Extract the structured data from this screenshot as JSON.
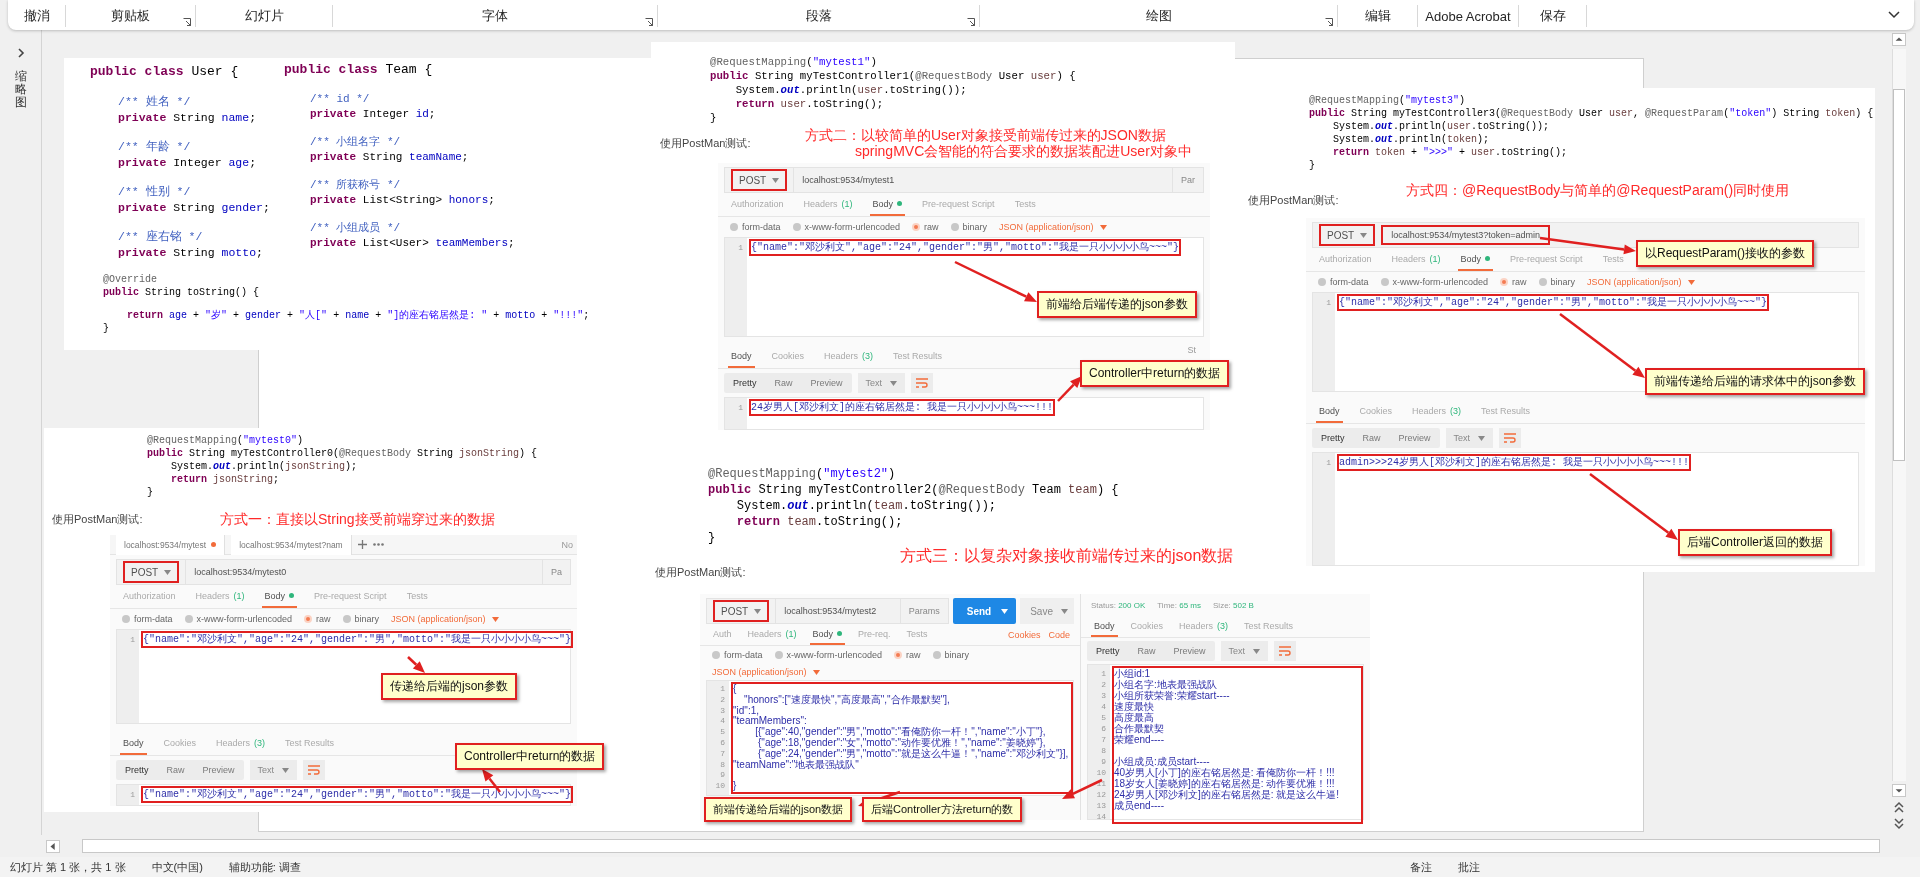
{
  "ribbon": {
    "groups": [
      {
        "label": "撤消",
        "launcher": false
      },
      {
        "label": "剪贴板",
        "launcher": true
      },
      {
        "label": "幻灯片",
        "launcher": false
      },
      {
        "label": "字体",
        "launcher": true
      },
      {
        "label": "段落",
        "launcher": true
      },
      {
        "label": "绘图",
        "launcher": true
      },
      {
        "label": "编辑",
        "launcher": false
      },
      {
        "label": "Adobe Acrobat",
        "launcher": false
      },
      {
        "label": "保存",
        "launcher": false
      }
    ]
  },
  "thumbnail_pane": {
    "label": "缩略图"
  },
  "slide": {
    "class_code": {
      "classes": [
        {
          "header": [
            {
              "kind": "keyword",
              "text": "public class "
            },
            {
              "kind": "plain",
              "text": "User {"
            }
          ],
          "members": [
            [
              [
                {
                  "kind": "comment",
                  "text": "/** 姓名 */"
                }
              ],
              [
                {
                  "kind": "keyword",
                  "text": "private "
                },
                {
                  "kind": "plain",
                  "text": "String "
                },
                {
                  "kind": "field",
                  "text": "name"
                },
                {
                  "kind": "plain",
                  "text": ";"
                }
              ]
            ],
            [
              [
                {
                  "kind": "comment",
                  "text": "/** 年龄 */"
                }
              ],
              [
                {
                  "kind": "keyword",
                  "text": "private "
                },
                {
                  "kind": "plain",
                  "text": "Integer "
                },
                {
                  "kind": "field",
                  "text": "age"
                },
                {
                  "kind": "plain",
                  "text": ";"
                }
              ]
            ],
            [
              [
                {
                  "kind": "comment",
                  "text": "/** 性别 */"
                }
              ],
              [
                {
                  "kind": "keyword",
                  "text": "private "
                },
                {
                  "kind": "plain",
                  "text": "String "
                },
                {
                  "kind": "field",
                  "text": "gender"
                },
                {
                  "kind": "plain",
                  "text": ";"
                }
              ]
            ],
            [
              [
                {
                  "kind": "comment",
                  "text": "/** 座右铭 */"
                }
              ],
              [
                {
                  "kind": "keyword",
                  "text": "private "
                },
                {
                  "kind": "plain",
                  "text": "String "
                },
                {
                  "kind": "field",
                  "text": "motto"
                },
                {
                  "kind": "plain",
                  "text": ";"
                }
              ]
            ]
          ]
        },
        {
          "header": [
            {
              "kind": "keyword",
              "text": "public class "
            },
            {
              "kind": "plain",
              "text": "Team {"
            }
          ],
          "members": [
            [
              [
                {
                  "kind": "comment",
                  "text": "/** id */"
                }
              ],
              [
                {
                  "kind": "keyword",
                  "text": "private "
                },
                {
                  "kind": "plain",
                  "text": "Integer "
                },
                {
                  "kind": "field",
                  "text": "id"
                },
                {
                  "kind": "plain",
                  "text": ";"
                }
              ]
            ],
            [
              [
                {
                  "kind": "comment",
                  "text": "/** 小组名字 */"
                }
              ],
              [
                {
                  "kind": "keyword",
                  "text": "private "
                },
                {
                  "kind": "plain",
                  "text": "String "
                },
                {
                  "kind": "field",
                  "text": "teamName"
                },
                {
                  "kind": "plain",
                  "text": ";"
                }
              ]
            ],
            [
              [
                {
                  "kind": "comment",
                  "text": "/** 所获称号 */"
                }
              ],
              [
                {
                  "kind": "keyword",
                  "text": "private "
                },
                {
                  "kind": "plain",
                  "text": "List<String> "
                },
                {
                  "kind": "field",
                  "text": "honors"
                },
                {
                  "kind": "plain",
                  "text": ";"
                }
              ]
            ],
            [
              [
                {
                  "kind": "comment",
                  "text": "/** 小组成员 */"
                }
              ],
              [
                {
                  "kind": "keyword",
                  "text": "private "
                },
                {
                  "kind": "plain",
                  "text": "List<User> "
                },
                {
                  "kind": "field",
                  "text": "teamMembers"
                },
                {
                  "kind": "plain",
                  "text": ";"
                }
              ]
            ]
          ]
        }
      ],
      "to_string": {
        "blocks": [
          [
            [
              {
                "kind": "annotation",
                "text": "@Override"
              }
            ],
            [
              {
                "kind": "keyword",
                "text": "public "
              },
              {
                "kind": "plain",
                "text": "String toString() {"
              }
            ]
          ],
          [
            [
              {
                "kind": "keyword",
                "text": "    return "
              },
              {
                "kind": "field",
                "text": "age"
              },
              {
                "kind": "plain",
                "text": " + "
              },
              {
                "kind": "string",
                "text": "\"岁\""
              },
              {
                "kind": "plain",
                "text": " + "
              },
              {
                "kind": "field",
                "text": "gender"
              },
              {
                "kind": "plain",
                "text": " + "
              },
              {
                "kind": "string",
                "text": "\"人[\""
              },
              {
                "kind": "plain",
                "text": " + "
              },
              {
                "kind": "field",
                "text": "name"
              },
              {
                "kind": "plain",
                "text": " + "
              },
              {
                "kind": "string",
                "text": "\"]的座右铭居然是: \""
              },
              {
                "kind": "plain",
                "text": " + "
              },
              {
                "kind": "field",
                "text": "motto"
              },
              {
                "kind": "plain",
                "text": " + "
              },
              {
                "kind": "string",
                "text": "\"!!!\""
              },
              {
                "kind": "plain",
                "text": ";"
              }
            ],
            [
              {
                "kind": "plain",
                "text": "}"
              }
            ]
          ]
        ]
      }
    },
    "examples": [
      {
        "code": [
          [
            {
              "kind": "annotation",
              "text": "@RequestMapping"
            },
            {
              "kind": "plain",
              "text": "("
            },
            {
              "kind": "string",
              "text": "\"mytest1\""
            },
            {
              "kind": "plain",
              "text": ")"
            }
          ],
          [
            {
              "kind": "keyword",
              "text": "public "
            },
            {
              "kind": "plain",
              "text": "String myTestController1("
            },
            {
              "kind": "annotation",
              "text": "@RequestBody "
            },
            {
              "kind": "plain",
              "text": "User "
            },
            {
              "kind": "variable",
              "text": "user"
            },
            {
              "kind": "plain",
              "text": ") {"
            }
          ],
          [
            {
              "kind": "plain",
              "text": "    System."
            },
            {
              "kind": "static",
              "text": "out"
            },
            {
              "kind": "plain",
              "text": ".println("
            },
            {
              "kind": "variable",
              "text": "user"
            },
            {
              "kind": "plain",
              "text": ".toString());"
            }
          ],
          [
            {
              "kind": "keyword",
              "text": "    return "
            },
            {
              "kind": "variable",
              "text": "user"
            },
            {
              "kind": "plain",
              "text": ".toString();"
            }
          ],
          [
            {
              "kind": "plain",
              "text": "}"
            }
          ]
        ],
        "test_label": "使用PostMan测试:",
        "title": [
          "方式二：以较简单的User对象接受前端传过来的JSON数据",
          "springMVC会智能的符合要求的数据装配进User对象中"
        ],
        "postman": {
          "kind": "stacked",
          "method": {
            "label": "POST",
            "highlighted": true
          },
          "url": {
            "text": "localhost:9534/mytest1",
            "highlighted": false
          },
          "url_extra": "Par",
          "request_tabs": [
            {
              "label": "Authorization",
              "selected": false
            },
            {
              "label": "Headers",
              "count": "(1)",
              "selected": false
            },
            {
              "label": "Body",
              "selected": true,
              "dot": true
            },
            {
              "label": "Pre-request Script",
              "selected": false
            },
            {
              "label": "Tests",
              "selected": false
            }
          ],
          "body_types": [
            {
              "label": "form-data",
              "selected": false
            },
            {
              "label": "x-www-form-urlencoded",
              "selected": false
            },
            {
              "label": "raw",
              "selected": true
            },
            {
              "label": "binary",
              "selected": false
            }
          ],
          "content_type": "JSON (application/json)",
          "request_body": {
            "highlighted": true,
            "lines": [
              {
                "no": "1",
                "text": "{\"name\":\"邓沙利文\",\"age\":\"24\",\"gender\":\"男\",\"motto\":\"我是一只小小小小鸟~~~\"}"
              }
            ]
          },
          "response_tabs": [
            {
              "label": "Body",
              "selected": true
            },
            {
              "label": "Cookies",
              "selected": false
            },
            {
              "label": "Headers",
              "count": "(3)",
              "selected": false
            },
            {
              "label": "Test Results",
              "selected": false
            }
          ],
          "response_extra": "St",
          "view_modes": [
            {
              "label": "Pretty",
              "selected": true
            },
            {
              "label": "Raw",
              "selected": false
            },
            {
              "label": "Preview",
              "selected": false
            }
          ],
          "format": "Text",
          "response_body": {
            "highlighted": true,
            "lines": [
              {
                "no": "1",
                "text": "24岁男人[邓沙利文]的座右铭居然是: 我是一只小小小小鸟~~~!!!"
              }
            ]
          }
        },
        "callouts": [
          {
            "text": "前端给后端传递的json参数"
          },
          {
            "text": "Controller中return的数据"
          }
        ]
      },
      {
        "code": [
          [
            {
              "kind": "annotation",
              "text": "@RequestMapping"
            },
            {
              "kind": "plain",
              "text": "("
            },
            {
              "kind": "string",
              "text": "\"mytest3\""
            },
            {
              "kind": "plain",
              "text": ")"
            }
          ],
          [
            {
              "kind": "keyword",
              "text": "public "
            },
            {
              "kind": "plain",
              "text": "String myTestController3("
            },
            {
              "kind": "annotation",
              "text": "@RequestBody "
            },
            {
              "kind": "plain",
              "text": "User "
            },
            {
              "kind": "variable",
              "text": "user"
            },
            {
              "kind": "plain",
              "text": ", "
            },
            {
              "kind": "annotation",
              "text": "@RequestParam"
            },
            {
              "kind": "plain",
              "text": "("
            },
            {
              "kind": "string",
              "text": "\"token\""
            },
            {
              "kind": "plain",
              "text": ") String "
            },
            {
              "kind": "variable",
              "text": "token"
            },
            {
              "kind": "plain",
              "text": ") {"
            }
          ],
          [
            {
              "kind": "plain",
              "text": "    System."
            },
            {
              "kind": "static",
              "text": "out"
            },
            {
              "kind": "plain",
              "text": ".println("
            },
            {
              "kind": "variable",
              "text": "user"
            },
            {
              "kind": "plain",
              "text": ".toString());"
            }
          ],
          [
            {
              "kind": "plain",
              "text": "    System."
            },
            {
              "kind": "static",
              "text": "out"
            },
            {
              "kind": "plain",
              "text": ".println("
            },
            {
              "kind": "variable",
              "text": "token"
            },
            {
              "kind": "plain",
              "text": ");"
            }
          ],
          [
            {
              "kind": "keyword",
              "text": "    return "
            },
            {
              "kind": "variable",
              "text": "token"
            },
            {
              "kind": "plain",
              "text": " + "
            },
            {
              "kind": "string",
              "text": "\">>>\""
            },
            {
              "kind": "plain",
              "text": " + "
            },
            {
              "kind": "variable",
              "text": "user"
            },
            {
              "kind": "plain",
              "text": ".toString();"
            }
          ],
          [
            {
              "kind": "plain",
              "text": "}"
            }
          ]
        ],
        "test_label": "使用PostMan测试:",
        "title": [
          "方式四：@RequestBody与简单的@RequestParam()同时使用"
        ],
        "postman": {
          "kind": "stacked",
          "method": {
            "label": "POST",
            "highlighted": true
          },
          "url": {
            "text": "localhost:9534/mytest3?token=admin",
            "highlighted": true
          },
          "request_tabs": [
            {
              "label": "Authorization",
              "selected": false
            },
            {
              "label": "Headers",
              "count": "(1)",
              "selected": false
            },
            {
              "label": "Body",
              "selected": true,
              "dot": true
            },
            {
              "label": "Pre-request Script",
              "selected": false
            },
            {
              "label": "Tests",
              "selected": false
            }
          ],
          "body_types": [
            {
              "label": "form-data",
              "selected": false
            },
            {
              "label": "x-www-form-urlencoded",
              "selected": false
            },
            {
              "label": "raw",
              "selected": true
            },
            {
              "label": "binary",
              "selected": false
            }
          ],
          "content_type": "JSON (application/json)",
          "request_body": {
            "highlighted": true,
            "lines": [
              {
                "no": "1",
                "text": "{\"name\":\"邓沙利文\",\"age\":\"24\",\"gender\":\"男\",\"motto\":\"我是一只小小小小鸟~~~\"}"
              }
            ]
          },
          "response_tabs": [
            {
              "label": "Body",
              "selected": true
            },
            {
              "label": "Cookies",
              "selected": false
            },
            {
              "label": "Headers",
              "count": "(3)",
              "selected": false
            },
            {
              "label": "Test Results",
              "selected": false
            }
          ],
          "view_modes": [
            {
              "label": "Pretty",
              "selected": true
            },
            {
              "label": "Raw",
              "selected": false
            },
            {
              "label": "Preview",
              "selected": false
            }
          ],
          "format": "Text",
          "response_body": {
            "highlighted": true,
            "lines": [
              {
                "no": "1",
                "text": "admin>>>24岁男人[邓沙利文]的座右铭居然是: 我是一只小小小小鸟~~~!!!"
              }
            ]
          }
        },
        "callouts": [
          {
            "text": "以RequestParam()接收的参数"
          },
          {
            "text": "前端传递给后端的请求体中的json参数"
          },
          {
            "text": "后端Controller返回的数据"
          }
        ]
      },
      {
        "code": [
          [
            {
              "kind": "annotation",
              "text": "@RequestMapping"
            },
            {
              "kind": "plain",
              "text": "("
            },
            {
              "kind": "string",
              "text": "\"mytest0\""
            },
            {
              "kind": "plain",
              "text": ")"
            }
          ],
          [
            {
              "kind": "keyword",
              "text": "public "
            },
            {
              "kind": "plain",
              "text": "String myTestController0("
            },
            {
              "kind": "annotation",
              "text": "@RequestBody "
            },
            {
              "kind": "plain",
              "text": "String "
            },
            {
              "kind": "variable",
              "text": "jsonString"
            },
            {
              "kind": "plain",
              "text": ") {"
            }
          ],
          [
            {
              "kind": "plain",
              "text": "    System."
            },
            {
              "kind": "static",
              "text": "out"
            },
            {
              "kind": "plain",
              "text": ".println("
            },
            {
              "kind": "variable",
              "text": "jsonString"
            },
            {
              "kind": "plain",
              "text": ");"
            }
          ],
          [
            {
              "kind": "keyword",
              "text": "    return "
            },
            {
              "kind": "variable",
              "text": "jsonString"
            },
            {
              "kind": "plain",
              "text": ";"
            }
          ],
          [
            {
              "kind": "plain",
              "text": "}"
            }
          ]
        ],
        "test_label": "使用PostMan测试:",
        "title": [
          "方式一：直接以String接受前端穿过来的数据"
        ],
        "postman": {
          "kind": "stacked",
          "tabs": [
            {
              "label": "localhost:9534/mytest",
              "modified": true
            },
            {
              "label": "localhost:9534/mytest?nam",
              "modified": false
            }
          ],
          "tab_extra": "No",
          "method": {
            "label": "POST",
            "highlighted": true
          },
          "url": {
            "text": "localhost:9534/mytest0",
            "highlighted": false
          },
          "url_extra": "Pa",
          "request_tabs": [
            {
              "label": "Authorization",
              "selected": false
            },
            {
              "label": "Headers",
              "count": "(1)",
              "selected": false
            },
            {
              "label": "Body",
              "selected": true,
              "dot": true
            },
            {
              "label": "Pre-request Script",
              "selected": false
            },
            {
              "label": "Tests",
              "selected": false
            }
          ],
          "body_types": [
            {
              "label": "form-data",
              "selected": false
            },
            {
              "label": "x-www-form-urlencoded",
              "selected": false
            },
            {
              "label": "raw",
              "selected": true
            },
            {
              "label": "binary",
              "selected": false
            }
          ],
          "content_type": "JSON (application/json)",
          "request_body": {
            "highlighted": true,
            "lines": [
              {
                "no": "1",
                "text": "{\"name\":\"邓沙利文\",\"age\":\"24\",\"gender\":\"男\",\"motto\":\"我是一只小小小小鸟~~~\"}"
              }
            ]
          },
          "response_tabs": [
            {
              "label": "Body",
              "selected": true
            },
            {
              "label": "Cookies",
              "selected": false
            },
            {
              "label": "Headers",
              "count": "(3)",
              "selected": false
            },
            {
              "label": "Test Results",
              "selected": false
            }
          ],
          "view_modes": [
            {
              "label": "Pretty",
              "selected": true
            },
            {
              "label": "Raw",
              "selected": false
            },
            {
              "label": "Preview",
              "selected": false
            }
          ],
          "format": "Text",
          "response_body": {
            "highlighted": true,
            "lines": [
              {
                "no": "1",
                "text": "{\"name\":\"邓沙利文\",\"age\":\"24\",\"gender\":\"男\",\"motto\":\"我是一只小小小小鸟~~~\"}"
              }
            ]
          }
        },
        "callouts": [
          {
            "text": "传递给后端的json参数"
          },
          {
            "text": "Controller中return的数据"
          }
        ]
      },
      {
        "code": [
          [
            {
              "kind": "annotation",
              "text": "@RequestMapping"
            },
            {
              "kind": "plain",
              "text": "("
            },
            {
              "kind": "string",
              "text": "\"mytest2\""
            },
            {
              "kind": "plain",
              "text": ")"
            }
          ],
          [
            {
              "kind": "keyword",
              "text": "public "
            },
            {
              "kind": "plain",
              "text": "String myTestController2("
            },
            {
              "kind": "annotation",
              "text": "@RequestBody "
            },
            {
              "kind": "plain",
              "text": "Team "
            },
            {
              "kind": "variable",
              "text": "team"
            },
            {
              "kind": "plain",
              "text": ") {"
            }
          ],
          [
            {
              "kind": "plain",
              "text": "    System."
            },
            {
              "kind": "static",
              "text": "out"
            },
            {
              "kind": "plain",
              "text": ".println("
            },
            {
              "kind": "variable",
              "text": "team"
            },
            {
              "kind": "plain",
              "text": ".toString());"
            }
          ],
          [
            {
              "kind": "keyword",
              "text": "    return "
            },
            {
              "kind": "variable",
              "text": "team"
            },
            {
              "kind": "plain",
              "text": ".toString();"
            }
          ],
          [
            {
              "kind": "plain",
              "text": "}"
            }
          ]
        ],
        "test_label": "使用PostMan测试:",
        "title": [
          "方式三：以复杂对象接收前端传过来的json数据"
        ],
        "postman": {
          "kind": "split",
          "method": {
            "label": "POST",
            "highlighted": true
          },
          "url": {
            "text": "localhost:9534/mytest2",
            "highlighted": false
          },
          "url_extra": "Params",
          "send": "Send",
          "save": "Save",
          "request_tabs": [
            {
              "label": "Auth",
              "selected": false
            },
            {
              "label": "Headers",
              "count": "(1)",
              "selected": false
            },
            {
              "label": "Body",
              "selected": true,
              "dot": true
            },
            {
              "label": "Pre-req.",
              "selected": false
            },
            {
              "label": "Tests",
              "selected": false
            }
          ],
          "links": [
            "Cookies",
            "Code"
          ],
          "body_types": [
            {
              "label": "form-data",
              "selected": false
            },
            {
              "label": "x-www-form-urlencoded",
              "selected": false
            },
            {
              "label": "raw",
              "selected": true
            },
            {
              "label": "binary",
              "selected": false
            }
          ],
          "content_type": "JSON (application/json)",
          "request_body": {
            "highlighted": true,
            "lines": [
              {
                "no": "1",
                "text": "{"
              },
              {
                "no": "2",
                "text": "    \"honors\":[\"速度最快\",\"高度最高\",\"合作最默契\"],"
              },
              {
                "no": "3",
                "text": "\"id\":1,"
              },
              {
                "no": "4",
                "text": "\"teamMembers\":"
              },
              {
                "no": "5",
                "text": "        [{\"age\":40,\"gender\":\"男\",\"motto\":\"看俺防你一杆！\",\"name\":\"小丁\"},"
              },
              {
                "no": "6",
                "text": "         {\"age\":18,\"gender\":\"女\",\"motto\":\"动作要优雅！\",\"name\":\"姜晓婷\"},"
              },
              {
                "no": "7",
                "text": "         {\"age\":24,\"gender\":\"男\",\"motto\":\"就是这么牛逼！\",\"name\":\"邓沙利文\"}],"
              },
              {
                "no": "8",
                "text": "\"teamName\":\"地表最强战队\""
              },
              {
                "no": "9"
              },
              {
                "no": "10",
                "text": "}"
              }
            ]
          },
          "status": [
            {
              "label": "Status:",
              "value": "200 OK"
            },
            {
              "label": "Time:",
              "value": "65 ms"
            },
            {
              "label": "Size:",
              "value": "502 B"
            }
          ],
          "response_tabs": [
            {
              "label": "Body",
              "selected": true
            },
            {
              "label": "Cookies",
              "selected": false
            },
            {
              "label": "Headers",
              "count": "(3)",
              "selected": false
            },
            {
              "label": "Test Results",
              "selected": false
            }
          ],
          "view_modes": [
            {
              "label": "Pretty",
              "selected": true
            },
            {
              "label": "Raw",
              "selected": false
            },
            {
              "label": "Preview",
              "selected": false
            }
          ],
          "format": "Text",
          "response_body": {
            "highlighted": true,
            "lines": [
              {
                "no": "1",
                "text": "小组id:1"
              },
              {
                "no": "2",
                "text": "小组名字:地表最强战队"
              },
              {
                "no": "3",
                "text": "小组所获荣誉:荣耀start----"
              },
              {
                "no": "4",
                "text": "速度最快"
              },
              {
                "no": "5",
                "text": "高度最高"
              },
              {
                "no": "6",
                "text": "合作最默契"
              },
              {
                "no": "7",
                "text": "荣耀end----"
              },
              {
                "no": "8"
              },
              {
                "no": "9",
                "text": "小组成员:成员start----"
              },
              {
                "no": "10",
                "text": "40岁男人[小丁]的座右铭居然是: 看俺防你一杆！!!!"
              },
              {
                "no": "11",
                "text": "18岁女人[姜晓婷]的座右铭居然是: 动作要优雅！!!!"
              },
              {
                "no": "12",
                "text": "24岁男人[邓沙利文]的座右铭居然是: 就是这么牛逼!"
              },
              {
                "no": "13",
                "text": "成员end----"
              },
              {
                "no": "14"
              }
            ]
          }
        },
        "callouts": [
          {
            "text": "前端传递给后端的json数据"
          },
          {
            "text": "后端Controller方法return的数"
          }
        ]
      }
    ]
  },
  "status_bar": {
    "left": [
      "幻灯片 第 1 张，共 1 张",
      "中文(中国)",
      "辅助功能: 调查"
    ],
    "right": [
      "备注",
      "批注"
    ]
  }
}
